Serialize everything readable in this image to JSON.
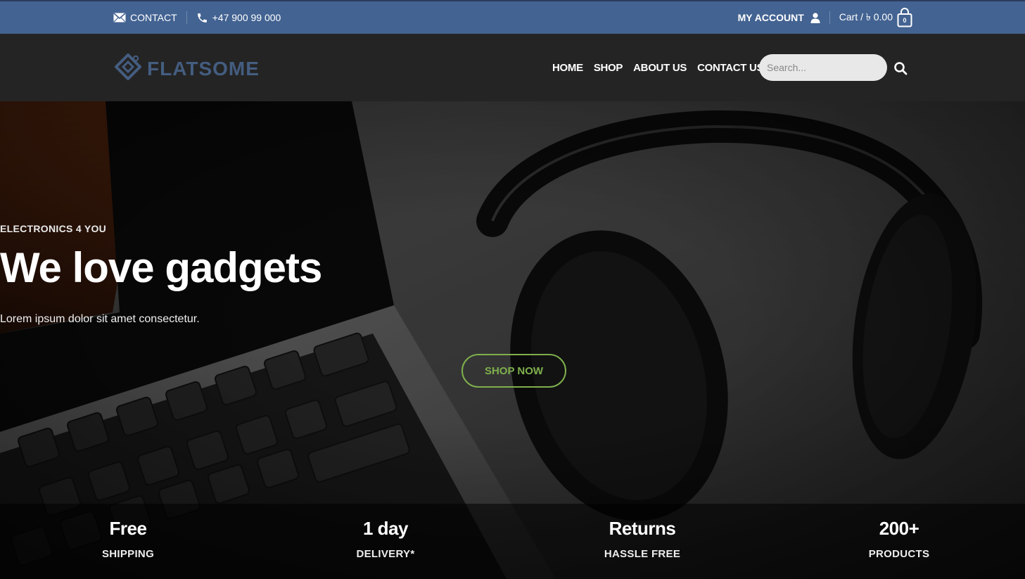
{
  "topbar": {
    "contact_label": "CONTACT",
    "phone": "+47 900 99 000",
    "account_label": "MY ACCOUNT",
    "cart_label": "Cart / ৳ 0.00",
    "cart_count": "0",
    "background": "#436392"
  },
  "header": {
    "logo_text": "FLATSOME",
    "nav": [
      "HOME",
      "SHOP",
      "ABOUT US",
      "CONTACT US"
    ],
    "search_placeholder": "Search...",
    "background": "#242424"
  },
  "hero": {
    "eyebrow": "ELECTRONICS 4 YOU",
    "headline": "We love gadgets",
    "subtext": "Lorem ipsum dolor sit amet consectetur.",
    "button_label": "SHOP NOW",
    "accent": "#7fb04d"
  },
  "features": [
    {
      "big": "Free",
      "small": "SHIPPING"
    },
    {
      "big": "1 day",
      "small": "DELIVERY*"
    },
    {
      "big": "Returns",
      "small": "HASSLE FREE"
    },
    {
      "big": "200+",
      "small": "PRODUCTS"
    }
  ]
}
